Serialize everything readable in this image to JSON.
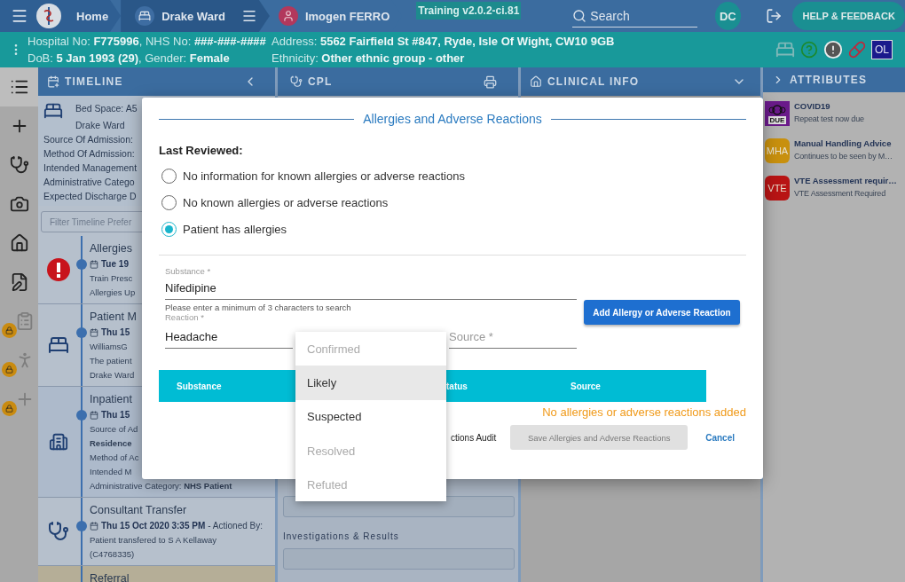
{
  "header": {
    "home": "Home",
    "ward": "Drake Ward",
    "patient": "Imogen FERRO",
    "build": "Training v2.0.2-ci.81",
    "search": {
      "placeholder": "Search"
    },
    "user": "DC",
    "help": "HELP & FEEDBACK"
  },
  "banner": {
    "left": [
      "Hospital No: **F775996**, NHS No: **###-###-####**",
      "DoB: **5 Jan 1993 (29)**, Gender: **Female**"
    ],
    "right": [
      "Address: **5562 Fairfield St #847, Ryde, Isle Of Wight, CW10 9GB**",
      "Ethnicity: **Other ethnic group - other**"
    ],
    "badge": "OL"
  },
  "rail": [
    {
      "kind": "list",
      "selected": true,
      "locked": false
    },
    {
      "kind": "plus",
      "selected": false,
      "locked": false
    },
    {
      "kind": "stethoscope",
      "selected": false,
      "locked": false
    },
    {
      "kind": "camera",
      "selected": false,
      "locked": false
    },
    {
      "kind": "home",
      "selected": false,
      "locked": false
    },
    {
      "kind": "sign",
      "selected": false,
      "locked": false
    },
    {
      "kind": "clipboard",
      "selected": false,
      "locked": true
    },
    {
      "kind": "walk",
      "selected": false,
      "locked": true
    },
    {
      "kind": "plus",
      "selected": false,
      "locked": true
    }
  ],
  "panes": {
    "timeline": "TIMELINE",
    "cpl": "CPL",
    "clinical": "CLINICAL INFO",
    "attributes": "ATTRIBUTES"
  },
  "bed_card": {
    "title_lines": [
      "Bed Space: A5",
      "Drake Ward"
    ],
    "lines": [
      "Source Of Admission:",
      "Method Of Admission:",
      "Intended Management",
      "Administrative Catego",
      "Expected Discharge D"
    ]
  },
  "timeline_filter": {
    "placeholder": "Filter Timeline Prefer"
  },
  "timeline": [
    {
      "kind": "allergy",
      "title": "Allergies",
      "date": "Tue 19",
      "lines": [
        {
          "text": "Train Presc",
          "bold": false
        },
        {
          "text": "Allergies Up",
          "bold": false
        }
      ]
    },
    {
      "kind": "bed",
      "title": "Patient M",
      "date": "Thu 15",
      "lines": [
        {
          "text": "WilliamsG",
          "bold": false
        },
        {
          "text": "The patient",
          "bold": false
        },
        {
          "text": "Drake Ward",
          "bold": false
        }
      ]
    },
    {
      "kind": "hospital",
      "title": "Inpatient",
      "date": "Thu 15",
      "lines": [
        {
          "text": "Source of Ad",
          "bold": false
        },
        {
          "text": "Residence",
          "bold": true
        },
        {
          "text": "Method of Ac",
          "bold": false
        },
        {
          "text": "Intended M",
          "bold": false
        },
        {
          "text": "Administrative Category: **NHS Patient**",
          "bold": false
        }
      ]
    },
    {
      "kind": "stethoscope",
      "title": "Consultant Transfer",
      "date": "Thu 15 Oct 2020 3:35 PM",
      "date_suffix": " - Actioned By:",
      "lines": [
        {
          "text": "Patient transfered to S A Kellaway",
          "bold": false
        },
        {
          "text": "(C4768335)",
          "bold": false
        }
      ]
    },
    {
      "kind": "referral",
      "title": "Referral"
    }
  ],
  "cpl": {
    "section": "Investigations & Results"
  },
  "attributes": [
    {
      "kind": "covid",
      "badge": "DUE",
      "title": "COVID19",
      "detail": "Repeat test now due"
    },
    {
      "kind": "mha",
      "badge": "MHA",
      "title": "Manual Handling Advice",
      "detail": "Continues to be seen by M…"
    },
    {
      "kind": "vte",
      "badge": "VTE",
      "title": "VTE Assessment requir…",
      "detail": "VTE Assessment Required"
    }
  ],
  "dialog": {
    "title": "Allergies and Adverse Reactions",
    "reviewed_label": "Last Reviewed:",
    "options": [
      {
        "label": "No information for known allergies or adverse reactions",
        "selected": false
      },
      {
        "label": "No known allergies or adverse reactions",
        "selected": false
      },
      {
        "label": "Patient has allergies",
        "selected": true
      }
    ],
    "substance": {
      "label": "Substance *",
      "value": "Nifedipine",
      "helper": "Please enter a minimum of 3 characters to search"
    },
    "add_button": "Add Allergy or Adverse Reaction",
    "reaction": {
      "label": "Reaction *",
      "value": "Headache"
    },
    "source": {
      "placeholder": "Source *"
    },
    "table_columns": [
      "Substance",
      "tatus",
      "Source"
    ],
    "empty": "No allergies or adverse reactions added",
    "audit_link": "ctions Audit",
    "save": {
      "label": "Save Allergies and Adverse Reactions",
      "disabled": true
    },
    "cancel": "Cancel"
  },
  "status_menu": [
    {
      "label": "Confirmed",
      "disabled": true,
      "highlighted": false
    },
    {
      "label": "Likely",
      "disabled": false,
      "highlighted": true
    },
    {
      "label": "Suspected",
      "disabled": false,
      "highlighted": false
    },
    {
      "label": "Resolved",
      "disabled": true,
      "highlighted": false
    },
    {
      "label": "Refuted",
      "disabled": true,
      "highlighted": false
    }
  ]
}
